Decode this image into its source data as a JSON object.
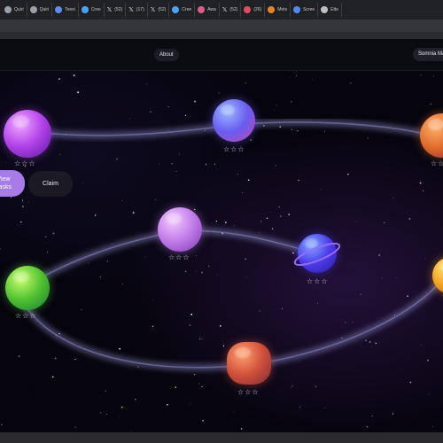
{
  "browser": {
    "tabs": [
      {
        "label": "Quiri",
        "icon": "globe-icon",
        "color": "#9aa0a6",
        "x": false
      },
      {
        "label": "Quiri",
        "icon": "globe-icon",
        "color": "#9aa0a6",
        "x": false
      },
      {
        "label": "Teesi",
        "icon": "teams-icon",
        "color": "#5b8cf0",
        "x": false
      },
      {
        "label": "Cree",
        "icon": "globe-icon",
        "color": "#4aa3ff",
        "x": false
      },
      {
        "label": "(52)",
        "icon": "x-icon",
        "color": "#ffffff",
        "x": true
      },
      {
        "label": "(17)",
        "icon": "x-icon",
        "color": "#ffffff",
        "x": true
      },
      {
        "label": "(52)",
        "icon": "x-icon",
        "color": "#ffffff",
        "x": true
      },
      {
        "label": "Cree",
        "icon": "globe-icon",
        "color": "#4aa3ff",
        "x": false
      },
      {
        "label": "Awa",
        "icon": "pin-icon",
        "color": "#e05a8a",
        "x": false
      },
      {
        "label": "(52)",
        "icon": "x-icon",
        "color": "#ffffff",
        "x": true
      },
      {
        "label": "(26)",
        "icon": "youtube-icon",
        "color": "#e04b5e",
        "x": false
      },
      {
        "label": "Mets",
        "icon": "fox-icon",
        "color": "#e8832a",
        "x": false
      },
      {
        "label": "Scree",
        "icon": "globe-icon",
        "color": "#4a8cff",
        "x": false
      },
      {
        "label": "Ette",
        "icon": "globe-icon",
        "color": "#c0c0c0",
        "x": false
      }
    ]
  },
  "navbar": {
    "about_label": "About",
    "user_label": "Somnia Ma"
  },
  "actions": {
    "view_tasks_label": "View\nTasks",
    "claim_label": "Claim"
  },
  "planets": [
    {
      "name": "purple-swirl-planet",
      "rating": "☆☆☆",
      "colors": [
        "#f0a8ff",
        "#b040e8",
        "#5a1a9a"
      ]
    },
    {
      "name": "blue-pink-planet",
      "rating": "☆☆☆",
      "colors": [
        "#9ab8ff",
        "#6a5cf0",
        "#c04ab0"
      ]
    },
    {
      "name": "orange-planet-top-right",
      "rating": "☆☆",
      "colors": [
        "#ffb070",
        "#e06a2a",
        "#8a2a3a"
      ]
    },
    {
      "name": "lilac-crater-planet",
      "rating": "☆☆☆",
      "colors": [
        "#f2c8ff",
        "#c07ae8",
        "#7a3ab0"
      ]
    },
    {
      "name": "ringed-blue-planet",
      "rating": "☆☆☆",
      "colors": [
        "#80a8ff",
        "#4a3ae8",
        "#2a1a9a"
      ]
    },
    {
      "name": "green-planet",
      "rating": "☆☆☆",
      "colors": [
        "#c8ff70",
        "#50c030",
        "#1a7a3a"
      ]
    },
    {
      "name": "yellow-planet-right",
      "rating": "",
      "colors": [
        "#ffe070",
        "#f0a020",
        "#b05a10"
      ]
    },
    {
      "name": "rocky-orange-planet",
      "rating": "☆☆☆",
      "colors": [
        "#ffa070",
        "#d0503a",
        "#7a2a3a"
      ]
    }
  ],
  "colors": {
    "accent": "#a77be8",
    "page_background": "#06040d",
    "orbit": "#8a8ac8"
  }
}
